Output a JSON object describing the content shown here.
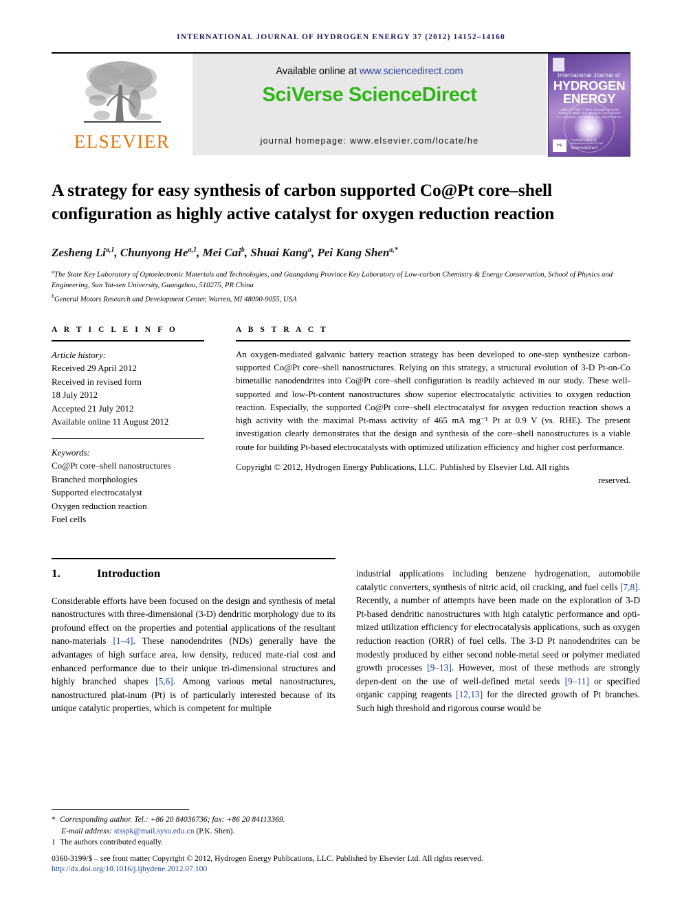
{
  "running_head": "INTERNATIONAL JOURNAL OF HYDROGEN ENERGY 37 (2012) 14152–14160",
  "masthead": {
    "publisher_name": "ELSEVIER",
    "available_prefix": "Available online at ",
    "available_url": "www.sciencedirect.com",
    "platform": "SciVerse ScienceDirect",
    "homepage": "journal homepage: www.elsevier.com/locate/he",
    "cover": {
      "line_small": "International Journal of",
      "line_big_1": "HYDROGEN",
      "line_big_2": "ENERGY",
      "editors": "Editor-in-Chief: T. Nejat Veziroğlu   Associate Editors: A. Bahis, E.C. Branduno, M.A. Gomez, K.L. Hermans, J.H. Shulting, S.A. Sherif and E.A. Veziroğlu",
      "science_direct_tiny": "Available online at www.sciencedirect.com",
      "science_direct": "ScienceDirect",
      "ihe_badge": "IHE"
    }
  },
  "title": "A strategy for easy synthesis of carbon supported Co@Pt core–shell configuration as highly active catalyst for oxygen reduction reaction",
  "authors": [
    {
      "name": "Zesheng Li",
      "sup": "a,1"
    },
    {
      "name": "Chunyong He",
      "sup": "a,1"
    },
    {
      "name": "Mei Cai",
      "sup": "b"
    },
    {
      "name": "Shuai Kang",
      "sup": "a"
    },
    {
      "name": "Pei Kang Shen",
      "sup": "a,*"
    }
  ],
  "affiliations": [
    {
      "mark": "a",
      "text": "The State Key Laboratory of Optoelectronic Materials and Technologies, and Guangdong Province Key Laboratory of Low-carbon Chemistry & Energy Conservation, School of Physics and Engineering, Sun Yat-sen University, Guangzhou, 510275, PR China"
    },
    {
      "mark": "b",
      "text": "General Motors Research and Development Center, Warren, MI 48090-9055, USA"
    }
  ],
  "article_info": {
    "heading": "A R T I C L E   I N F O",
    "history_label": "Article history:",
    "history": [
      "Received 29 April 2012",
      "Received in revised form",
      "18 July 2012",
      "Accepted 21 July 2012",
      "Available online 11 August 2012"
    ],
    "keywords_label": "Keywords:",
    "keywords": [
      "Co@Pt core–shell nanostructures",
      "Branched morphologies",
      "Supported electrocatalyst",
      "Oxygen reduction reaction",
      "Fuel cells"
    ]
  },
  "abstract": {
    "heading": "A B S T R A C T",
    "text": "An oxygen-mediated galvanic battery reaction strategy has been developed to one-step synthesize carbon-supported Co@Pt core–shell nanostructures. Relying on this strategy, a structural evolution of 3-D Pt-on-Co bimetallic nanodendrites into Co@Pt core–shell configuration is readily achieved in our study. These well-supported and low-Pt-content nanostructures show superior electrocatalytic activities to oxygen reduction reaction. Especially, the supported Co@Pt core–shell electrocatalyst for oxygen reduction reaction shows a high activity with the maximal Pt-mass activity of 465 mA mg⁻¹ Pt at 0.9 V (vs. RHE). The present investigation clearly demonstrates that the design and synthesis of the core–shell nanostructures is a viable route for building Pt-based electrocatalysts with optimized utilization efficiency and higher cost performance.",
    "copyright": "Copyright © 2012, Hydrogen Energy Publications, LLC. Published by Elsevier Ltd. All rights",
    "copyright_end": "reserved."
  },
  "section": {
    "number": "1.",
    "name": "Introduction"
  },
  "body": {
    "left_part1": "Considerable efforts have been focused on the design and synthesis of metal nanostructures with three-dimensional (3-D) dendritic morphology due to its profound effect on the properties and potential applications of the resultant nano-materials ",
    "left_ref1": "[1–4]",
    "left_part2": ". These nanodendrites (NDs) generally have the advantages of high surface area, low density, reduced mate-rial cost and enhanced performance due to their unique tri-dimensional structures and highly branched shapes ",
    "left_ref2": "[5,6]",
    "left_part3": ". Among various metal nanostructures, nanostructured plat-inum (Pt) is of particularly interested because of its unique catalytic properties, which is competent for multiple",
    "right_part1": "industrial applications including benzene hydrogenation, automobile catalytic converters, synthesis of nitric acid, oil cracking, and fuel cells ",
    "right_ref1": "[7,8]",
    "right_part2": ". Recently, a number of attempts have been made on the exploration of 3-D Pt-based dendritic nanostructures with high catalytic performance and opti-mized utilization efficiency for electrocatalysis applications, such as oxygen reduction reaction (ORR) of fuel cells. The 3-D Pt nanodendrites can be modestly produced by either second noble-metal seed or polymer mediated growth processes ",
    "right_ref2": "[9–13]",
    "right_part3": ". However, most of these methods are strongly depen-dent on the use of well-defined metal seeds ",
    "right_ref3": "[9–11]",
    "right_part4": " or specified organic capping reagents ",
    "right_ref4": "[12,13]",
    "right_part5": " for the directed growth of Pt branches. Such high threshold and rigorous course would be"
  },
  "footnotes": {
    "corresponding": "Corresponding author. Tel.: +86 20 84036736; fax: +86 20 84113369.",
    "email_label": "E-mail address: ",
    "email": "stsspk@mail.sysu.edu.cn",
    "email_suffix": " (P.K. Shen).",
    "equal_mark": "1",
    "equal": "The authors contributed equally.",
    "issn": "0360-3199/$ – see front matter Copyright © 2012, Hydrogen Energy Publications, LLC. Published by Elsevier Ltd. All rights reserved.",
    "doi": "http://dx.doi.org/10.1016/j.ijhydene.2012.07.100"
  },
  "colors": {
    "running_head": "#1b1b5e",
    "elsevier_orange": "#ec7404",
    "sciverse_green": "#2cb514",
    "link_blue": "#1b3f8f"
  }
}
